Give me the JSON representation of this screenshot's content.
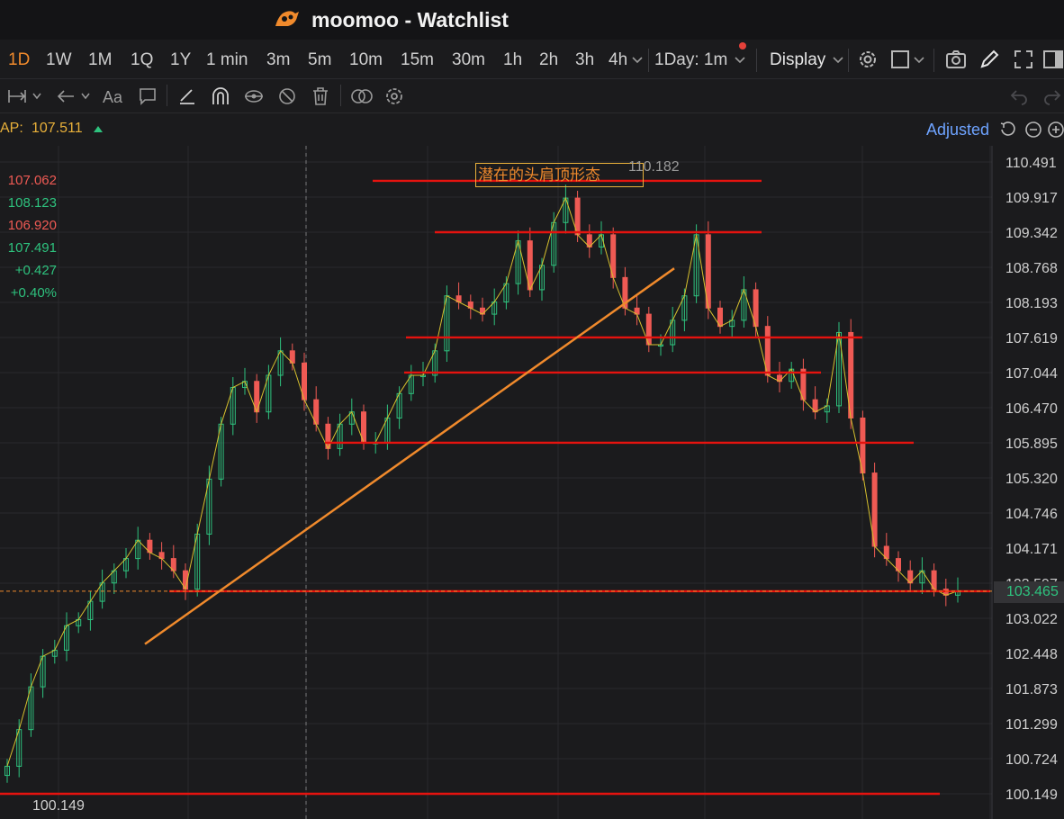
{
  "window": {
    "title": "moomoo - Watchlist"
  },
  "toolbar": {
    "timeframes": [
      "1D",
      "1W",
      "1M",
      "1Q",
      "1Y",
      "1 min",
      "3m",
      "5m",
      "10m",
      "15m",
      "30m",
      "1h",
      "2h",
      "3h",
      "4h"
    ],
    "active_timeframe": "1D",
    "interval_select": "1Day: 1m",
    "display_label": "Display"
  },
  "vwap": {
    "label": "AP:",
    "value": "107.511"
  },
  "adjusted_label": "Adjusted",
  "ohlc": {
    "open": "107.062",
    "high": "108.123",
    "low": "106.920",
    "close": "107.491",
    "change": "+0.427",
    "change_pct": "+0.40%"
  },
  "annotation": {
    "text": "潜在的头肩顶形态",
    "high_marker": "110.182"
  },
  "current_price": "103.465",
  "low_marker": "100.149",
  "colors": {
    "up": "#2ec27e",
    "down": "#ef5a54",
    "accent": "#f08a2c",
    "level_line": "#e5130f"
  },
  "chart_data": {
    "type": "candlestick",
    "y_ticks": [
      "110.491",
      "109.917",
      "109.342",
      "108.768",
      "108.193",
      "107.619",
      "107.044",
      "106.470",
      "105.895",
      "105.320",
      "104.746",
      "104.171",
      "103.597",
      "103.022",
      "102.448",
      "101.873",
      "101.299",
      "100.724",
      "100.149"
    ],
    "ylim": [
      100.149,
      110.491
    ],
    "horizontal_levels": [
      110.182,
      109.342,
      107.619,
      107.044,
      105.895,
      103.465,
      100.149
    ],
    "trendline": {
      "from_price": 102.6,
      "to_price": 108.75
    },
    "closes": [
      100.6,
      101.2,
      101.9,
      102.4,
      102.5,
      102.9,
      103.0,
      103.3,
      103.6,
      103.8,
      104.0,
      104.3,
      104.1,
      104.0,
      103.8,
      103.5,
      104.4,
      105.3,
      106.2,
      106.8,
      106.9,
      106.4,
      107.0,
      107.4,
      107.2,
      106.6,
      106.2,
      105.8,
      106.2,
      106.4,
      105.9,
      105.9,
      106.3,
      106.7,
      107.0,
      107.0,
      107.4,
      108.3,
      108.2,
      108.1,
      108.0,
      108.2,
      108.5,
      109.2,
      108.4,
      108.8,
      109.5,
      109.9,
      109.3,
      109.1,
      109.3,
      108.6,
      108.1,
      108.0,
      107.5,
      107.5,
      107.9,
      108.3,
      109.3,
      108.1,
      107.8,
      107.9,
      108.4,
      107.8,
      107.0,
      106.9,
      107.1,
      106.6,
      106.4,
      106.5,
      107.7,
      106.3,
      105.4,
      104.2,
      104.0,
      103.8,
      103.6,
      103.8,
      103.5,
      103.4,
      103.47
    ]
  }
}
